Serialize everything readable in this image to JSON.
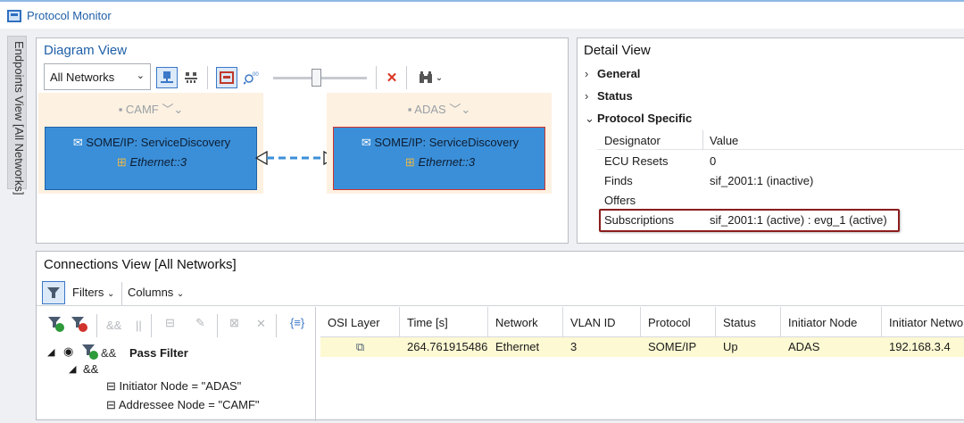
{
  "app": {
    "title": "Protocol Monitor"
  },
  "side_tab": {
    "label": "Endpoints View [All Networks]"
  },
  "diagram": {
    "title": "Diagram View",
    "network_select": "All Networks",
    "nodes": [
      {
        "name": "CAMF",
        "service": "SOME/IP: ServiceDiscovery",
        "transport": "Ethernet::3",
        "selected": false
      },
      {
        "name": "ADAS",
        "service": "SOME/IP: ServiceDiscovery",
        "transport": "Ethernet::3",
        "selected": true
      }
    ],
    "accent": "#3b8fd8"
  },
  "detail": {
    "title": "Detail View",
    "sections": [
      "General",
      "Status",
      "Protocol Specific"
    ],
    "header": {
      "key": "Designator",
      "value": "Value"
    },
    "rows": [
      {
        "key": "ECU Resets",
        "value": "0"
      },
      {
        "key": "Finds",
        "value": "sif_2001:1 (inactive)"
      },
      {
        "key": "Offers",
        "value": ""
      },
      {
        "key": "Subscriptions",
        "value": "sif_2001:1 (active) : evg_1 (active)"
      }
    ]
  },
  "connections": {
    "title": "Connections View [All Networks]",
    "filters_label": "Filters",
    "columns_label": "Columns",
    "filter_tree": {
      "and_op": "&&",
      "root_label": "Pass Filter",
      "conditions": [
        "Initiator Node = \"ADAS\"",
        "Addressee Node = \"CAMF\""
      ]
    },
    "grid": {
      "headers": [
        "OSI Layer",
        "Time [s]",
        "Network",
        "VLAN ID",
        "Protocol",
        "Status",
        "Initiator Node",
        "Initiator Netwo"
      ],
      "rows": [
        {
          "time": "264.761915486",
          "network": "Ethernet",
          "vlan": "3",
          "protocol": "SOME/IP",
          "status": "Up",
          "initiator": "ADAS",
          "initiator_net": "192.168.3.4"
        }
      ],
      "row_color": "#fdf9d3"
    }
  }
}
